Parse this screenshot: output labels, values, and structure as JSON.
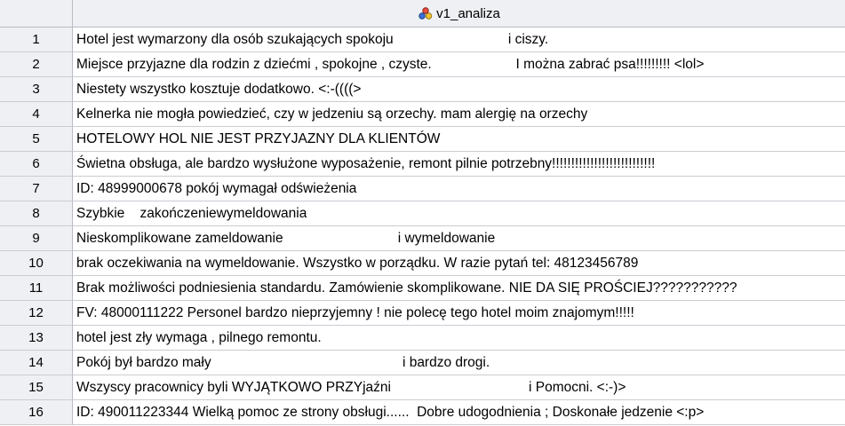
{
  "header": {
    "column_name": "v1_analiza",
    "column_icon": "nominal-variable-icon"
  },
  "rows": [
    {
      "num": "1",
      "text": "Hotel jest wymarzony dla osób szukających spokoju                              i ciszy."
    },
    {
      "num": "2",
      "text": "Miejsce przyjazne dla rodzin z dziećmi , spokojne , czyste.                      I można zabrać psa!!!!!!!!! <lol>"
    },
    {
      "num": "3",
      "text": "Niestety wszystko kosztuje dodatkowo. <:-((((>"
    },
    {
      "num": "4",
      "text": "Kelnerka nie mogła powiedzieć, czy w jedzeniu są orzechy. mam alergię na orzechy"
    },
    {
      "num": "5",
      "text": "HOTELOWY HOL NIE JEST PRZYJAZNY DLA KLIENTÓW"
    },
    {
      "num": "6",
      "text": "Świetna obsługa, ale bardzo wysłużone wyposażenie, remont pilnie potrzebny!!!!!!!!!!!!!!!!!!!!!!!!!!!"
    },
    {
      "num": "7",
      "text": "ID: 48999000678 pokój wymagał odświeżenia"
    },
    {
      "num": "8",
      "text": "Szybkie    zakończeniewymeldowania"
    },
    {
      "num": "9",
      "text": "Nieskomplikowane zameldowanie                              i wymeldowanie"
    },
    {
      "num": "10",
      "text": "brak oczekiwania na wymeldowanie. Wszystko w porządku. W razie pytań tel: 48123456789"
    },
    {
      "num": "11",
      "text": "Brak możliwości podniesienia standardu. Zamówienie skomplikowane. NIE DA SIĘ PROŚCIEJ???????????"
    },
    {
      "num": "12",
      "text": "FV: 48000111222 Personel bardzo nieprzyjemny ! nie polecę tego hotel moim znajomym!!!!!"
    },
    {
      "num": "13",
      "text": "hotel jest zły wymaga , pilnego remontu."
    },
    {
      "num": "14",
      "text": "Pokój był bardzo mały                                                  i bardzo drogi."
    },
    {
      "num": "15",
      "text": "Wszyscy pracownicy byli WYJĄTKOWO PRZYjaźni                                    i Pomocni. <:-)>"
    },
    {
      "num": "16",
      "text": "ID: 490011223344 Wielką pomoc ze strony obsługi......  Dobre udogodnienia ; Doskonałe jedzenie <:p>"
    }
  ]
}
